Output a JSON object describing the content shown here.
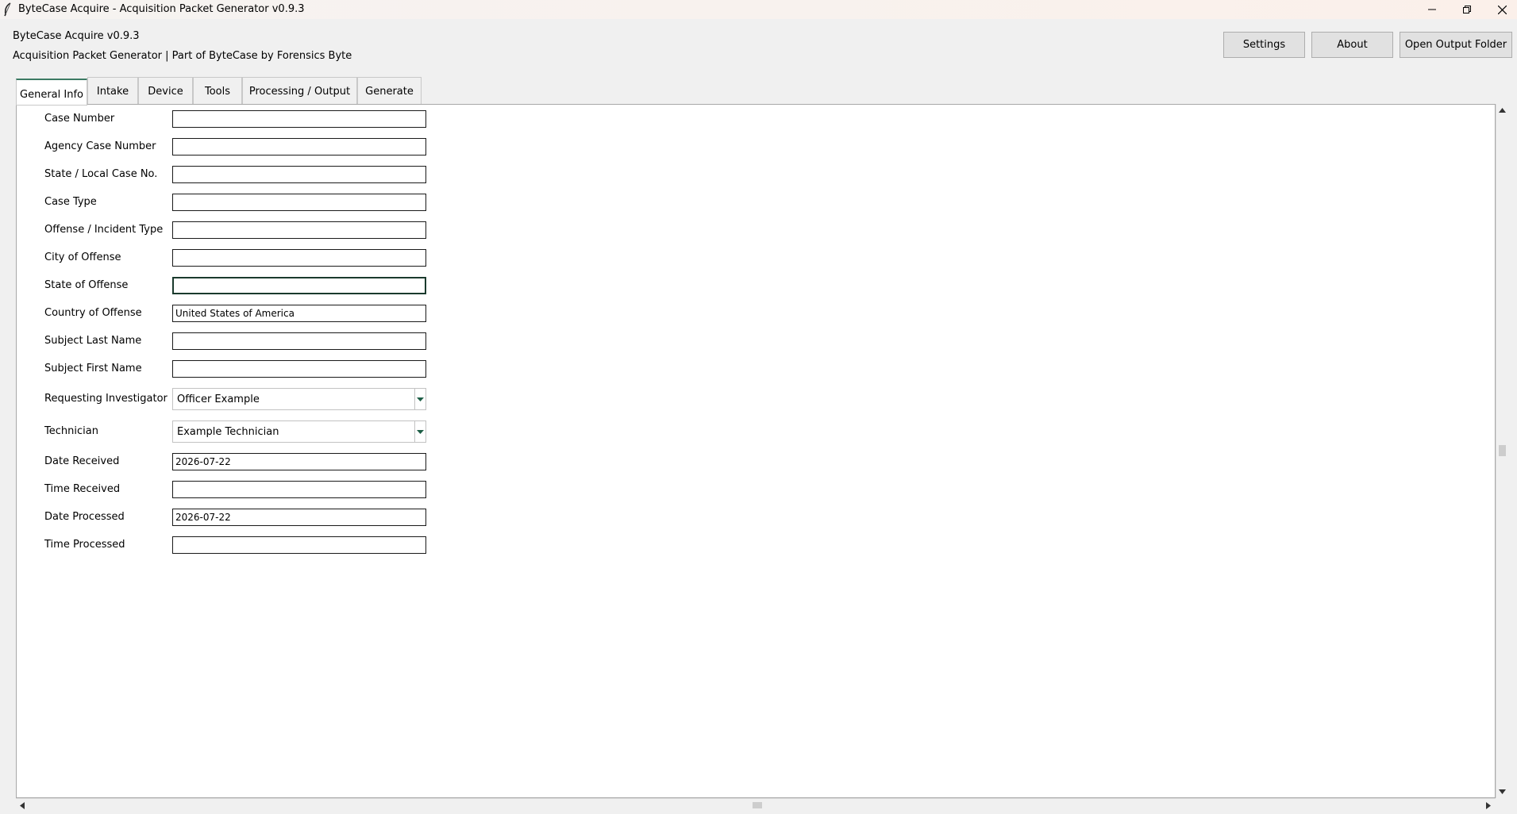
{
  "window": {
    "title": "ByteCase Acquire - Acquisition Packet Generator v0.9.3"
  },
  "header": {
    "app_name": "ByteCase Acquire v0.9.3",
    "subtitle": "Acquisition Packet Generator | Part of ByteCase by Forensics Byte"
  },
  "toolbar": {
    "settings_label": "Settings",
    "about_label": "About",
    "open_output_label": "Open Output Folder"
  },
  "tabs": [
    {
      "label": "General Info",
      "active": true
    },
    {
      "label": "Intake",
      "active": false
    },
    {
      "label": "Device",
      "active": false
    },
    {
      "label": "Tools",
      "active": false
    },
    {
      "label": "Processing / Output",
      "active": false
    },
    {
      "label": "Generate",
      "active": false
    }
  ],
  "form": {
    "case_number": {
      "label": "Case Number",
      "value": ""
    },
    "agency_case_number": {
      "label": "Agency Case Number",
      "value": ""
    },
    "state_local_case_no": {
      "label": "State / Local Case No.",
      "value": ""
    },
    "case_type": {
      "label": "Case Type",
      "value": ""
    },
    "offense_incident_type": {
      "label": "Offense / Incident Type",
      "value": ""
    },
    "city_of_offense": {
      "label": "City of Offense",
      "value": ""
    },
    "state_of_offense": {
      "label": "State of Offense",
      "value": ""
    },
    "country_of_offense": {
      "label": "Country of Offense",
      "value": "United States of America"
    },
    "subject_last_name": {
      "label": "Subject Last Name",
      "value": ""
    },
    "subject_first_name": {
      "label": "Subject First Name",
      "value": ""
    },
    "requesting_investigator": {
      "label": "Requesting Investigator",
      "value": "Officer Example"
    },
    "technician": {
      "label": "Technician",
      "value": "Example Technician"
    },
    "date_received": {
      "label": "Date Received",
      "value": "2026-07-22"
    },
    "time_received": {
      "label": "Time Received",
      "value": ""
    },
    "date_processed": {
      "label": "Date Processed",
      "value": "2026-07-22"
    },
    "time_processed": {
      "label": "Time Processed",
      "value": ""
    }
  },
  "colors": {
    "accent": "#3c7a63",
    "combo_arrow": "#1d5e46"
  },
  "icons": {
    "app": "feather-icon",
    "minimize": "minimize-icon",
    "restore": "restore-icon",
    "close": "close-icon",
    "dropdown": "chevron-down-icon"
  }
}
